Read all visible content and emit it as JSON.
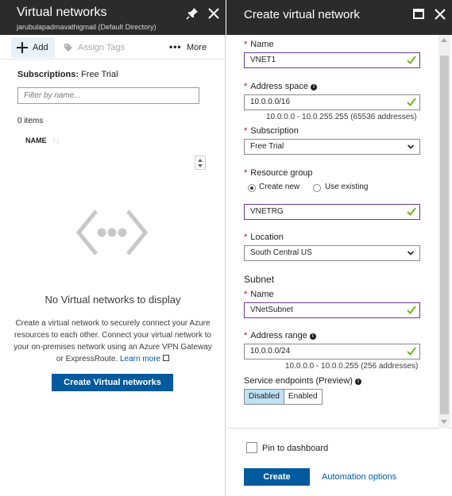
{
  "left_blade": {
    "title": "Virtual networks",
    "subtitle": "jarubulapadmavathigmail (Default Directory)",
    "toolbar": {
      "add_label": "Add",
      "assign_tags_label": "Assign Tags",
      "more_label": "More"
    },
    "subscriptions_label": "Subscriptions:",
    "subscriptions_value": "Free Trial",
    "filter_placeholder": "Filter by name...",
    "items_count": "0 items",
    "column_name": "NAME",
    "empty_title": "No Virtual networks to display",
    "empty_description": "Create a virtual network to securely connect your Azure resources to each other. Connect your virtual network to your on-premises network using an Azure VPN Gateway or ExpressRoute.",
    "learn_more_label": "Learn more",
    "create_button_label": "Create Virtual networks"
  },
  "right_blade": {
    "title": "Create virtual network",
    "form": {
      "name_label": "Name",
      "name_value": "VNET1",
      "address_space_label": "Address space",
      "address_space_value": "10.0.0.0/16",
      "address_space_hint": "10.0.0.0 - 10.0.255.255 (65536 addresses)",
      "subscription_label": "Subscription",
      "subscription_value": "Free Trial",
      "resource_group_label": "Resource group",
      "rg_create_new_label": "Create new",
      "rg_use_existing_label": "Use existing",
      "rg_selected": "create_new",
      "resource_group_value": "VNETRG",
      "location_label": "Location",
      "location_value": "South Central US",
      "subnet_section": "Subnet",
      "subnet_name_label": "Name",
      "subnet_name_value": "VNetSubnet",
      "address_range_label": "Address range",
      "address_range_value": "10.0.0.0/24",
      "address_range_hint": "10.0.0.0 - 10.0.0.255 (256 addresses)",
      "service_endpoints_label": "Service endpoints (Preview)",
      "service_endpoints_options": [
        "Disabled",
        "Enabled"
      ],
      "service_endpoints_selected": "Disabled"
    },
    "footer": {
      "pin_label": "Pin to dashboard",
      "pin_checked": false,
      "create_label": "Create",
      "automation_label": "Automation options"
    }
  },
  "colors": {
    "header_bg": "#2b2b2b",
    "primary_button": "#005a9e",
    "link": "#0058ad",
    "required": "#c7001f",
    "valid_check": "#5bb000",
    "valid_border": "#6c3a8e",
    "segment_active": "#bfe1f4"
  }
}
